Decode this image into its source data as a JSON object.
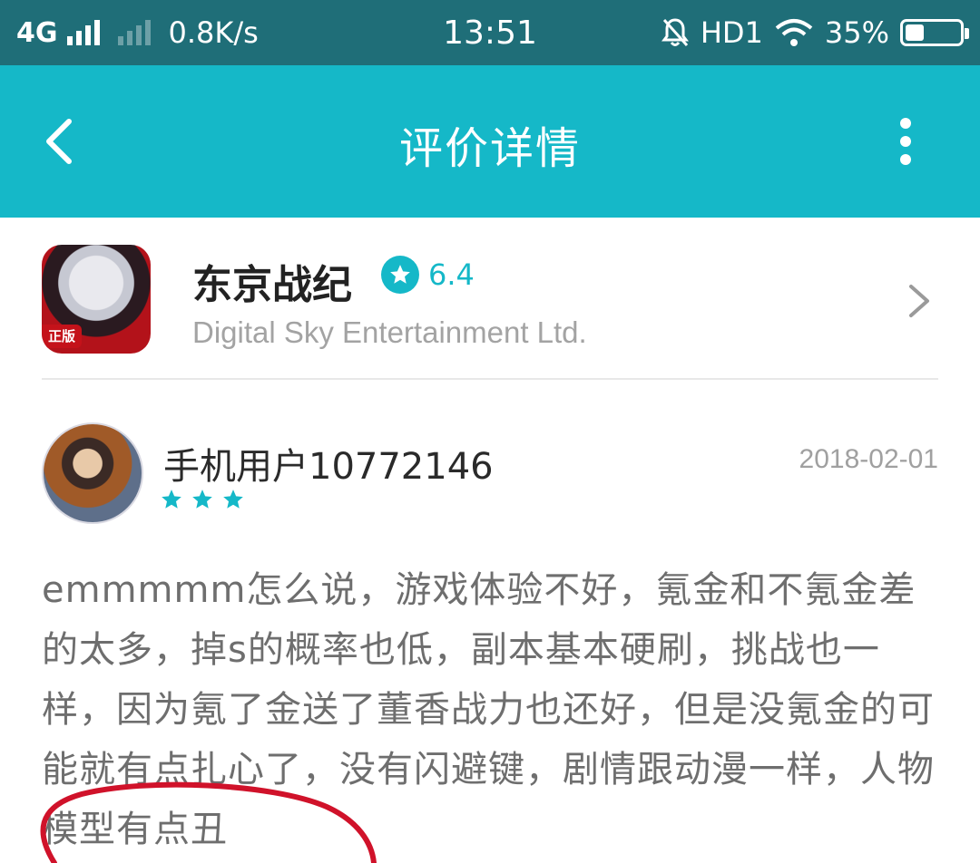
{
  "status_bar": {
    "network": "4G",
    "speed": "0.8K/s",
    "time": "13:51",
    "hd": "HD1",
    "battery_percent": "35%",
    "battery_level": 0.35
  },
  "header": {
    "title": "评价详情"
  },
  "app": {
    "name": "东京战纪",
    "rating": "6.4",
    "developer": "Digital Sky Entertainment Ltd.",
    "icon_tag": "正版"
  },
  "review": {
    "user_name": "手机用户10772146",
    "date": "2018-02-01",
    "stars": 3,
    "text": "emmmmm怎么说，游戏体验不好，氪金和不氪金差的太多，掉s的概率也低，副本基本硬刷，挑战也一样，因为氪了金送了董香战力也还好，但是没氪金的可能就有点扎心了，没有闪避键，剧情跟动漫一样，人物模型有点丑"
  },
  "colors": {
    "status_bar_bg": "#1f6e78",
    "app_bar_bg": "#15b8c8",
    "accent": "#15b8c8",
    "annotation_red": "#d0122a"
  },
  "icons": [
    "back-icon",
    "more-vertical-icon",
    "star-badge-icon",
    "chevron-right-icon",
    "star-icon",
    "signal-icon",
    "mute-bell-icon",
    "wifi-icon",
    "battery-icon"
  ]
}
